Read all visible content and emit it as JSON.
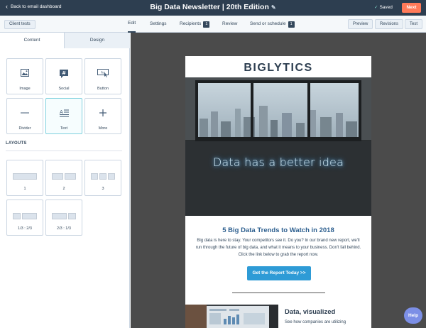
{
  "header": {
    "back_label": "Back to email dashboard",
    "title": "Big Data Newsletter | 20th Edition",
    "saved_label": "Saved",
    "next_label": "Next"
  },
  "toolbar": {
    "client_tests_label": "Client tests",
    "tabs": [
      {
        "label": "Edit",
        "badge": ""
      },
      {
        "label": "Settings",
        "badge": ""
      },
      {
        "label": "Recipients",
        "badge": "1"
      },
      {
        "label": "Review",
        "badge": ""
      },
      {
        "label": "Send or schedule",
        "badge": "1"
      }
    ],
    "preview_label": "Preview",
    "revisions_label": "Revisions",
    "test_label": "Test"
  },
  "panel": {
    "tabs": [
      "Content",
      "Design"
    ],
    "modules": [
      {
        "label": "Image",
        "icon": "image-icon"
      },
      {
        "label": "Social",
        "icon": "hashtag-icon"
      },
      {
        "label": "Button",
        "icon": "button-cursor-icon"
      },
      {
        "label": "Divider",
        "icon": "divider-icon"
      },
      {
        "label": "Text",
        "icon": "text-align-icon"
      },
      {
        "label": "More",
        "icon": "plus-icon"
      }
    ],
    "layouts_heading": "LAYOUTS",
    "layouts": [
      "1",
      "2",
      "3",
      "1/3 : 2/3",
      "2/3 : 1/3"
    ]
  },
  "email": {
    "logo": "BIGLYTICS",
    "hero_neon_text": "Data has a better idea",
    "headline": "5 Big Data Trends to Watch in 2018",
    "body": "Big data is here to stay. Your competitors see it. Do you? In our brand new report, we'll run through the future of big data, and what it means to your business. Don't fall behind. Click the link below to grab the report now.",
    "cta_label": "Get the Report Today >>",
    "section2_title": "Data, visualized",
    "section2_body": "See how companies are utilizing"
  },
  "help_label": "Help",
  "colors": {
    "header_bg": "#2d3e50",
    "next_button": "#ff7a59",
    "cta_button": "#2e9bd6",
    "headline": "#2d5f8f",
    "help_button": "#7c8fe6"
  }
}
